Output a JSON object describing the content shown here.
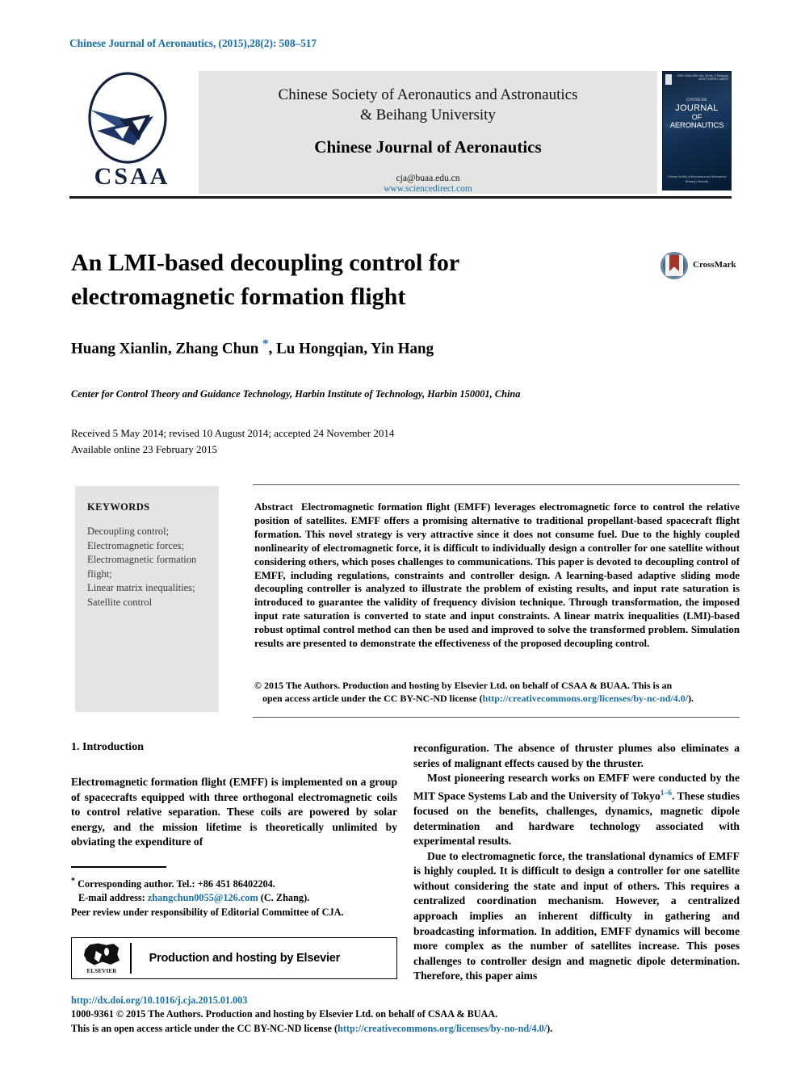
{
  "running_head": "Chinese Journal of Aeronautics, (2015),28(2): 508–517",
  "masthead": {
    "logo_text": "CSAA",
    "society_line1": "Chinese Society of Aeronautics and Astronautics",
    "society_line2": "& Beihang University",
    "journal_name": "Chinese Journal of Aeronautics",
    "email": "cja@buaa.edu.cn",
    "url": "www.sciencedirect.com",
    "cover": {
      "chinese_label": "CHINESE",
      "line1": "JOURNAL",
      "line2": "OF",
      "line3": "AERONAUTICS",
      "issue_info": "ISSN 1000-9361  Vol. 28 No. 2 February 2015  CODEN CJAEEZ",
      "footer_line1": "Chinese Society of Aeronautics and Astronautics",
      "footer_line2": "Beihang University"
    }
  },
  "article": {
    "title": "An LMI-based decoupling control for electromagnetic formation flight",
    "crossmark_label": "CrossMark",
    "authors": "Huang Xianlin, Zhang Chun ",
    "authors_rest": ", Lu Hongqian, Yin Hang",
    "corresponding_marker": "*",
    "affiliation": "Center for Control Theory and Guidance Technology, Harbin Institute of Technology, Harbin 150001, China",
    "dates_line1": "Received 5 May 2014; revised 10 August 2014; accepted 24 November 2014",
    "dates_line2": "Available online 23 February 2015"
  },
  "keywords": {
    "heading": "KEYWORDS",
    "items": [
      "Decoupling control;",
      "Electromagnetic forces;",
      "Electromagnetic formation",
      "flight;",
      "Linear matrix inequalities;",
      "Satellite control"
    ]
  },
  "abstract": {
    "label": "Abstract",
    "text": "Electromagnetic formation flight (EMFF) leverages electromagnetic force to control the relative position of satellites. EMFF offers a promising alternative to traditional propellant-based spacecraft flight formation. This novel strategy is very attractive since it does not consume fuel. Due to the highly coupled nonlinearity of electromagnetic force, it is difficult to individually design a controller for one satellite without considering others, which poses challenges to communications. This paper is devoted to decoupling control of EMFF, including regulations, constraints and controller design. A learning-based adaptive sliding mode decoupling controller is analyzed to illustrate the problem of existing results, and input rate saturation is introduced to guarantee the validity of frequency division technique. Through transformation, the imposed input rate saturation is converted to state and input constraints. A linear matrix inequalities (LMI)-based robust optimal control method can then be used and improved to solve the transformed problem. Simulation results are presented to demonstrate the effectiveness of the proposed decoupling control.",
    "copyright_line1": "© 2015 The Authors. Production and hosting by Elsevier Ltd. on behalf of CSAA & BUAA.  This is an",
    "copyright_line2_pre": "open access article under the CC BY-NC-ND license (",
    "copyright_link": "http://creativecommons.org/licenses/by-nc-nd/4.0/",
    "copyright_line2_post": ")."
  },
  "body": {
    "section_heading": "1. Introduction",
    "left_paragraph_1": "Electromagnetic formation flight (EMFF) is implemented on a group of spacecrafts equipped with three orthogonal electromagnetic coils to control relative separation. These coils are powered by solar energy, and the mission lifetime is theoretically unlimited by obviating the expenditure of",
    "right_paragraph_1": "reconfiguration. The absence of thruster plumes also eliminates a series of malignant effects caused by the thruster.",
    "right_paragraph_2_pre": "Most pioneering research works on EMFF were conducted by the MIT Space Systems Lab and the University of Tokyo",
    "right_citation": "1–6",
    "right_paragraph_2_post": ". These studies focused on the benefits, challenges, dynamics, magnetic dipole determination and hardware technology associated with experimental results.",
    "right_paragraph_3": "Due to electromagnetic force, the translational dynamics of EMFF is highly coupled. It is difficult to design a controller for one satellite without considering the state and input of others. This requires a centralized coordination mechanism. However, a centralized approach implies an inherent difficulty in gathering and broadcasting information. In addition, EMFF dynamics will become more complex as the number of satellites increase. This poses challenges to controller design and magnetic dipole determination. Therefore, this paper aims"
  },
  "footnote": {
    "corresponding": "Corresponding author. Tel.: +86 451 86402204.",
    "email_label": "E-mail address:",
    "email": "zhangchun0055@126.com",
    "email_suffix": "(C. Zhang).",
    "peer_review": "Peer review under responsibility of Editorial Committee of CJA."
  },
  "elsevier": {
    "logo_word": "ELSEVIER",
    "text": "Production and hosting by Elsevier"
  },
  "footer": {
    "doi": "http://dx.doi.org/10.1016/j.cja.2015.01.003",
    "line1": "1000-9361 © 2015 The Authors. Production and hosting by Elsevier Ltd. on behalf of CSAA & BUAA.",
    "line2_pre": "This is an open access article under the CC BY-NC-ND license (",
    "line2_link": "http://creativecommons.org/licenses/by-no-nd/4.0/",
    "line2_post": ")."
  },
  "colors": {
    "link_blue": "#1a6fa3",
    "keyword_bg": "#e4e4e4",
    "masthead_bg": "#e4e4e4"
  }
}
